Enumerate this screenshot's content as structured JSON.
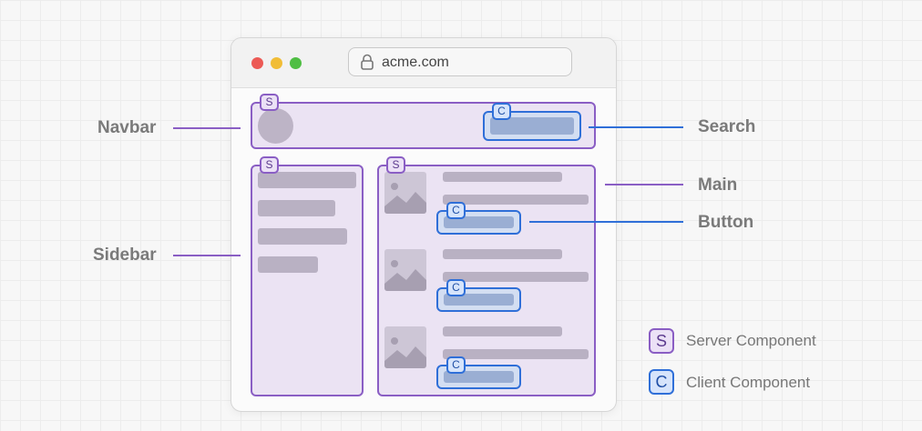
{
  "browser": {
    "url": "acme.com"
  },
  "badges": {
    "server": "S",
    "client": "C"
  },
  "callouts": {
    "navbar": "Navbar",
    "sidebar": "Sidebar",
    "search": "Search",
    "main": "Main",
    "button": "Button"
  },
  "legend": [
    {
      "badge": "S",
      "label": "Server Component"
    },
    {
      "badge": "C",
      "label": "Client Component"
    }
  ],
  "colors": {
    "server": "#8a5ec4",
    "client": "#2f6fd8",
    "traffic_red": "#ec5a55",
    "traffic_yellow": "#f1bd36",
    "traffic_green": "#4fbe43"
  },
  "icons": {
    "lock": "lock-icon",
    "image": "image-placeholder-icon"
  }
}
